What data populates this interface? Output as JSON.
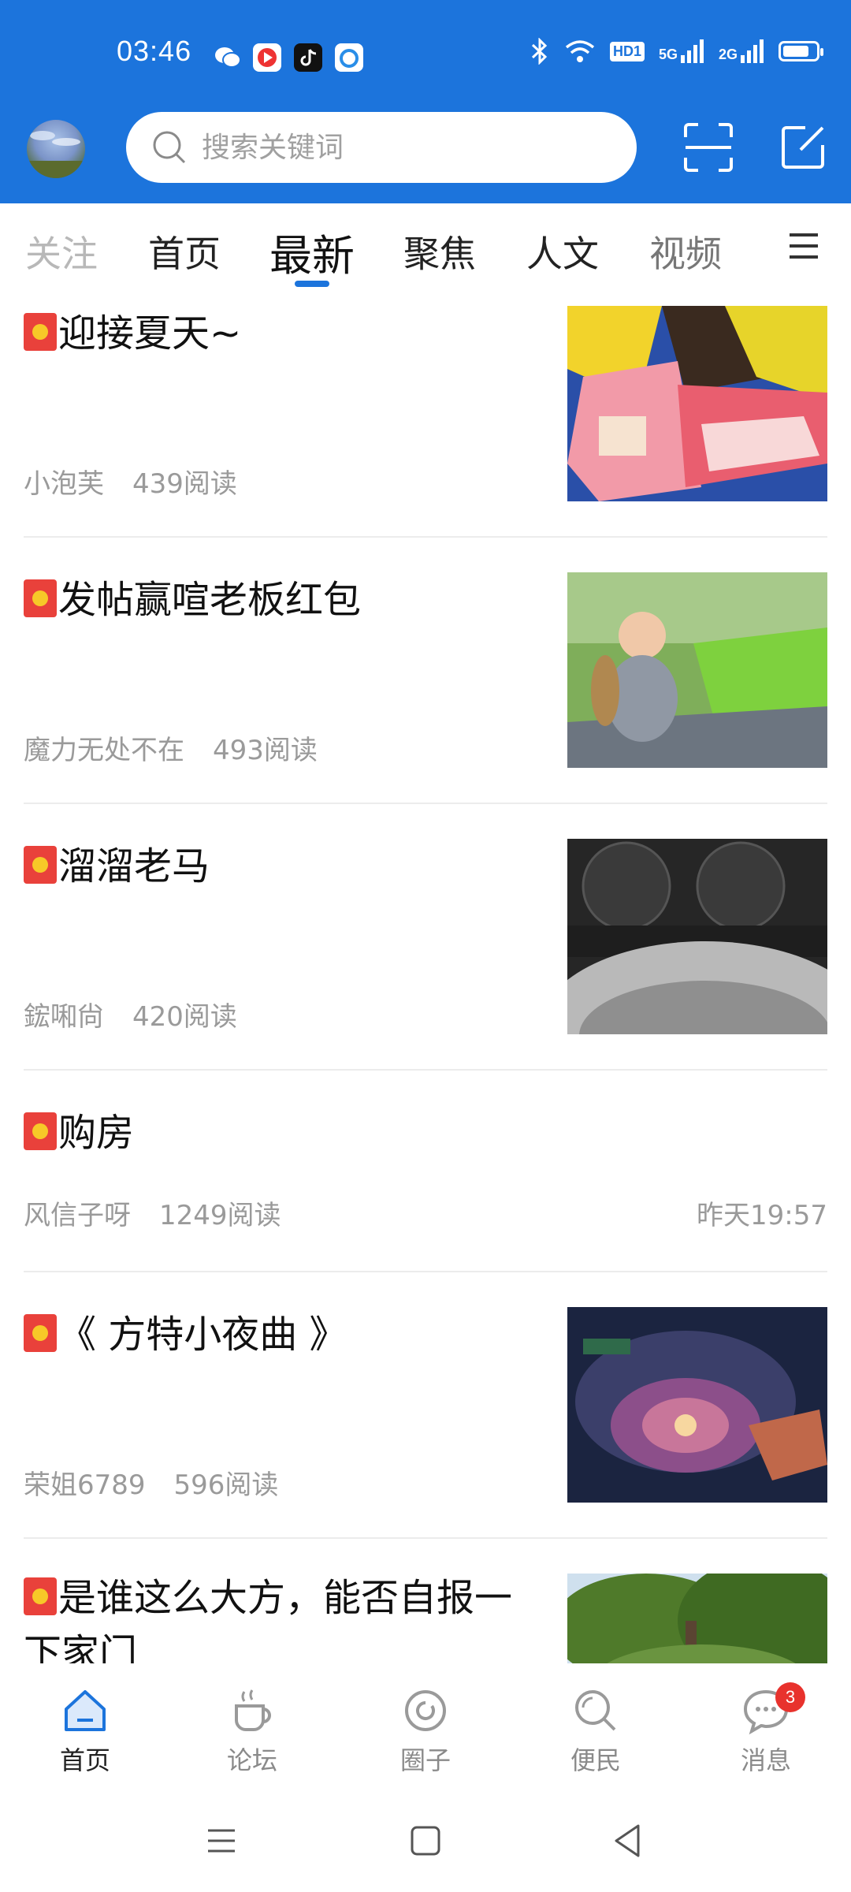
{
  "status_bar": {
    "time": "03:46",
    "notifications": [
      "wechat-icon",
      "video-app-icon",
      "tiktok-icon",
      "browser-icon"
    ],
    "badges": [
      "HD1",
      "5G",
      "2G"
    ],
    "battery_level": 0.8
  },
  "header": {
    "search_placeholder": "搜索关键词",
    "scan_icon": "scan-icon",
    "compose_icon": "compose-icon"
  },
  "tabs": [
    {
      "label": "关注"
    },
    {
      "label": "首页"
    },
    {
      "label": "最新"
    },
    {
      "label": "聚焦"
    },
    {
      "label": "人文"
    },
    {
      "label": "视频"
    }
  ],
  "feed": [
    {
      "title": "迎接夏天~",
      "author": "小泡芙",
      "reads": "439阅读"
    },
    {
      "title": "发帖赢喧老板红包",
      "author": "魔力无处不在",
      "reads": "493阅读"
    },
    {
      "title": "溜溜老马",
      "author": "鋐啝尙",
      "reads": "420阅读"
    },
    {
      "title": "购房",
      "author": "风信子呀",
      "reads": "1249阅读",
      "time": "昨天19:57"
    },
    {
      "title": "《 方特小夜曲 》",
      "author": "荣姐6789",
      "reads": "596阅读"
    },
    {
      "title": "是谁这么大方，能否自报一下家门"
    }
  ],
  "bottom_nav": [
    {
      "label": "首页",
      "icon": "home-icon"
    },
    {
      "label": "论坛",
      "icon": "coffee-icon"
    },
    {
      "label": "圈子",
      "icon": "circle-icon"
    },
    {
      "label": "便民",
      "icon": "search-icon"
    },
    {
      "label": "消息",
      "icon": "message-icon",
      "badge": "3"
    }
  ],
  "colors": {
    "brand": "#1c74dc",
    "badge": "#e8322d"
  }
}
